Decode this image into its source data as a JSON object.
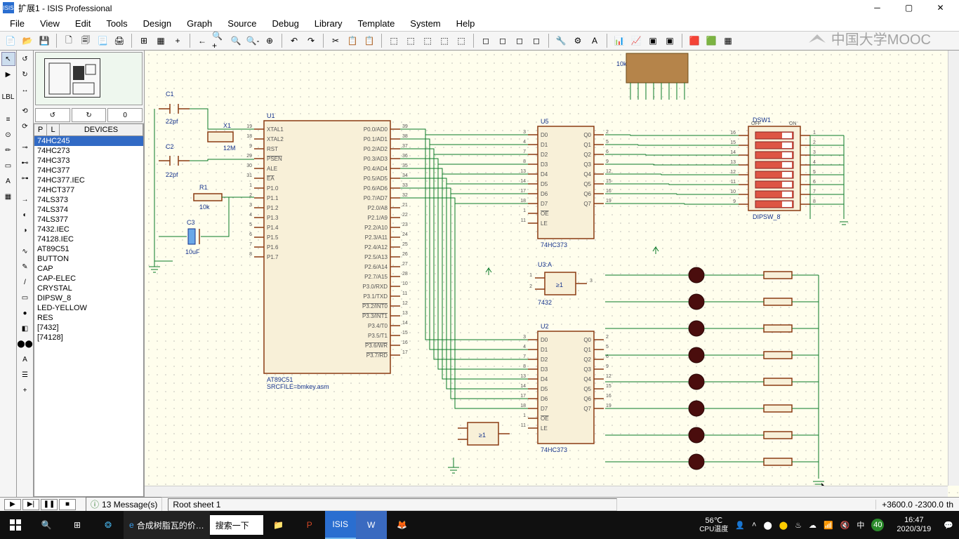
{
  "titlebar": {
    "title": "扩展1 - ISIS Professional"
  },
  "menu": {
    "items": [
      "File",
      "View",
      "Edit",
      "Tools",
      "Design",
      "Graph",
      "Source",
      "Debug",
      "Library",
      "Template",
      "System",
      "Help"
    ]
  },
  "watermark": "中国大学MOOC",
  "navinput": "0",
  "devices": {
    "headers": {
      "p": "P",
      "l": "L",
      "d": "DEVICES"
    },
    "selected": 0,
    "items": [
      "74HC245",
      "74HC273",
      "74HC373",
      "74HC377",
      "74HC377.IEC",
      "74HCT377",
      "74LS373",
      "74LS374",
      "74LS377",
      "7432.IEC",
      "74128.IEC",
      "AT89C51",
      "BUTTON",
      "CAP",
      "CAP-ELEC",
      "CRYSTAL",
      "DIPSW_8",
      "LED-YELLOW",
      "RES",
      "[7432]",
      "[74128]"
    ]
  },
  "status": {
    "messages": "13 Message(s)",
    "sheet": "Root sheet 1",
    "coords": "+3600.0   -2300.0",
    "unit": "th"
  },
  "taskbar": {
    "browserText": "合成树脂瓦的价…",
    "search": "搜索一下",
    "temp": "56℃",
    "templabel": "CPU温度",
    "ime": "中",
    "time": "16:47",
    "date": "2020/3/19"
  },
  "schematic": {
    "C1": "C1",
    "C1v": "22pf",
    "C2": "C2",
    "C2v": "22pf",
    "C3": "C3",
    "C3v": "10uF",
    "X1": "X1",
    "X1v": "12M",
    "R1": "R1",
    "R1v": "10k",
    "rnet_label": "10k",
    "U1": "U1",
    "U1v": "AT89C51",
    "U1src": "SRCFILE=bmkey.asm",
    "U2": "U2",
    "U2v": "74HC373",
    "U3": "U3:A",
    "U3v": "7432",
    "U5": "U5",
    "U5v": "74HC373",
    "DSW1": "DSW1",
    "DSW1v": "DIPSW_8",
    "DSW_off": "OFF",
    "DSW_on": "ON",
    "u1_pins_left": [
      {
        "n": "19",
        "t": "XTAL1"
      },
      {
        "n": "18",
        "t": "XTAL2"
      },
      {
        "n": "9",
        "t": "RST"
      },
      {
        "n": "29",
        "t": "PSEN",
        "ov": true
      },
      {
        "n": "30",
        "t": "ALE"
      },
      {
        "n": "31",
        "t": "EA",
        "ov": true
      },
      {
        "n": "1",
        "t": "P1.0"
      },
      {
        "n": "2",
        "t": "P1.1"
      },
      {
        "n": "3",
        "t": "P1.2"
      },
      {
        "n": "4",
        "t": "P1.3"
      },
      {
        "n": "5",
        "t": "P1.4"
      },
      {
        "n": "6",
        "t": "P1.5"
      },
      {
        "n": "7",
        "t": "P1.6"
      },
      {
        "n": "8",
        "t": "P1.7"
      }
    ],
    "u1_pins_right": [
      {
        "n": "39",
        "t": "P0.0/AD0"
      },
      {
        "n": "38",
        "t": "P0.1/AD1"
      },
      {
        "n": "37",
        "t": "P0.2/AD2"
      },
      {
        "n": "36",
        "t": "P0.3/AD3"
      },
      {
        "n": "35",
        "t": "P0.4/AD4"
      },
      {
        "n": "34",
        "t": "P0.5/AD5"
      },
      {
        "n": "33",
        "t": "P0.6/AD6"
      },
      {
        "n": "32",
        "t": "P0.7/AD7"
      },
      {
        "n": "21",
        "t": "P2.0/A8"
      },
      {
        "n": "22",
        "t": "P2.1/A9"
      },
      {
        "n": "23",
        "t": "P2.2/A10"
      },
      {
        "n": "24",
        "t": "P2.3/A11"
      },
      {
        "n": "25",
        "t": "P2.4/A12"
      },
      {
        "n": "26",
        "t": "P2.5/A13"
      },
      {
        "n": "27",
        "t": "P2.6/A14"
      },
      {
        "n": "28",
        "t": "P2.7/A15"
      },
      {
        "n": "10",
        "t": "P3.0/RXD"
      },
      {
        "n": "11",
        "t": "P3.1/TXD"
      },
      {
        "n": "12",
        "t": "P3.2/INT0",
        "ov": true
      },
      {
        "n": "13",
        "t": "P3.3/INT1",
        "ov": true
      },
      {
        "n": "14",
        "t": "P3.4/T0"
      },
      {
        "n": "15",
        "t": "P3.5/T1"
      },
      {
        "n": "16",
        "t": "P3.6/WR",
        "ov": true
      },
      {
        "n": "17",
        "t": "P3.7/RD",
        "ov": true
      }
    ],
    "u373_left": [
      {
        "n": "3",
        "t": "D0"
      },
      {
        "n": "4",
        "t": "D1"
      },
      {
        "n": "7",
        "t": "D2"
      },
      {
        "n": "8",
        "t": "D3"
      },
      {
        "n": "13",
        "t": "D4"
      },
      {
        "n": "14",
        "t": "D5"
      },
      {
        "n": "17",
        "t": "D6"
      },
      {
        "n": "18",
        "t": "D7"
      },
      {
        "n": "1",
        "t": "OE",
        "ov": true
      },
      {
        "n": "11",
        "t": "LE"
      }
    ],
    "u373_right": [
      {
        "n": "2",
        "t": "Q0"
      },
      {
        "n": "5",
        "t": "Q1"
      },
      {
        "n": "6",
        "t": "Q2"
      },
      {
        "n": "9",
        "t": "Q3"
      },
      {
        "n": "12",
        "t": "Q4"
      },
      {
        "n": "15",
        "t": "Q5"
      },
      {
        "n": "16",
        "t": "Q6"
      },
      {
        "n": "19",
        "t": "Q7"
      }
    ],
    "dsw_left": [
      "16",
      "15",
      "14",
      "13",
      "12",
      "11",
      "10",
      "9"
    ],
    "dsw_right": [
      "1",
      "2",
      "3",
      "4",
      "5",
      "6",
      "7",
      "8"
    ]
  }
}
